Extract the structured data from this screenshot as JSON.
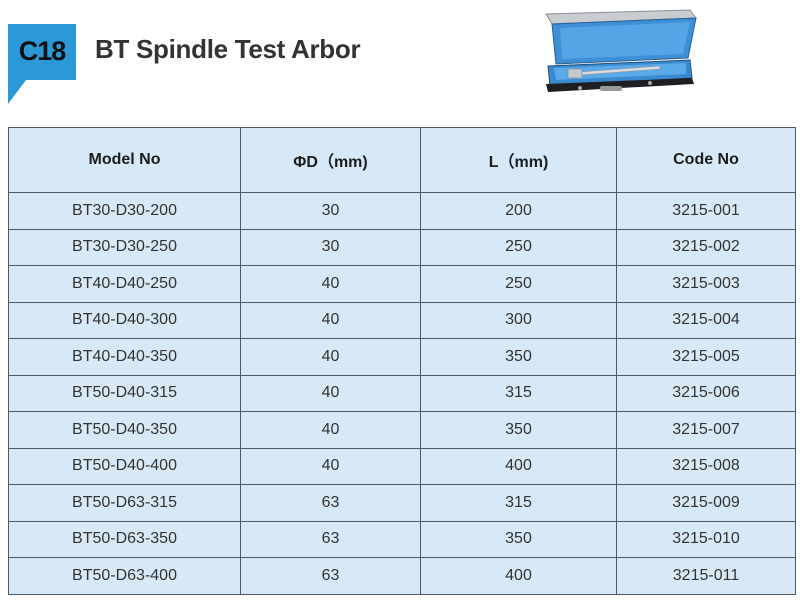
{
  "header": {
    "badge": "C18",
    "title": "BT Spindle Test Arbor",
    "badge_color": "#2b98d8"
  },
  "product_image": "aluminum-case-with-test-arbor",
  "table": {
    "columns": [
      "Model No",
      "ΦD（mm)",
      "L（mm)",
      "Code No"
    ],
    "rows": [
      [
        "BT30-D30-200",
        "30",
        "200",
        "3215-001"
      ],
      [
        "BT30-D30-250",
        "30",
        "250",
        "3215-002"
      ],
      [
        "BT40-D40-250",
        "40",
        "250",
        "3215-003"
      ],
      [
        "BT40-D40-300",
        "40",
        "300",
        "3215-004"
      ],
      [
        "BT40-D40-350",
        "40",
        "350",
        "3215-005"
      ],
      [
        "BT50-D40-315",
        "40",
        "315",
        "3215-006"
      ],
      [
        "BT50-D40-350",
        "40",
        "350",
        "3215-007"
      ],
      [
        "BT50-D40-400",
        "40",
        "400",
        "3215-008"
      ],
      [
        "BT50-D63-315",
        "63",
        "315",
        "3215-009"
      ],
      [
        "BT50-D63-350",
        "63",
        "350",
        "3215-010"
      ],
      [
        "BT50-D63-400",
        "63",
        "400",
        "3215-011"
      ]
    ]
  }
}
